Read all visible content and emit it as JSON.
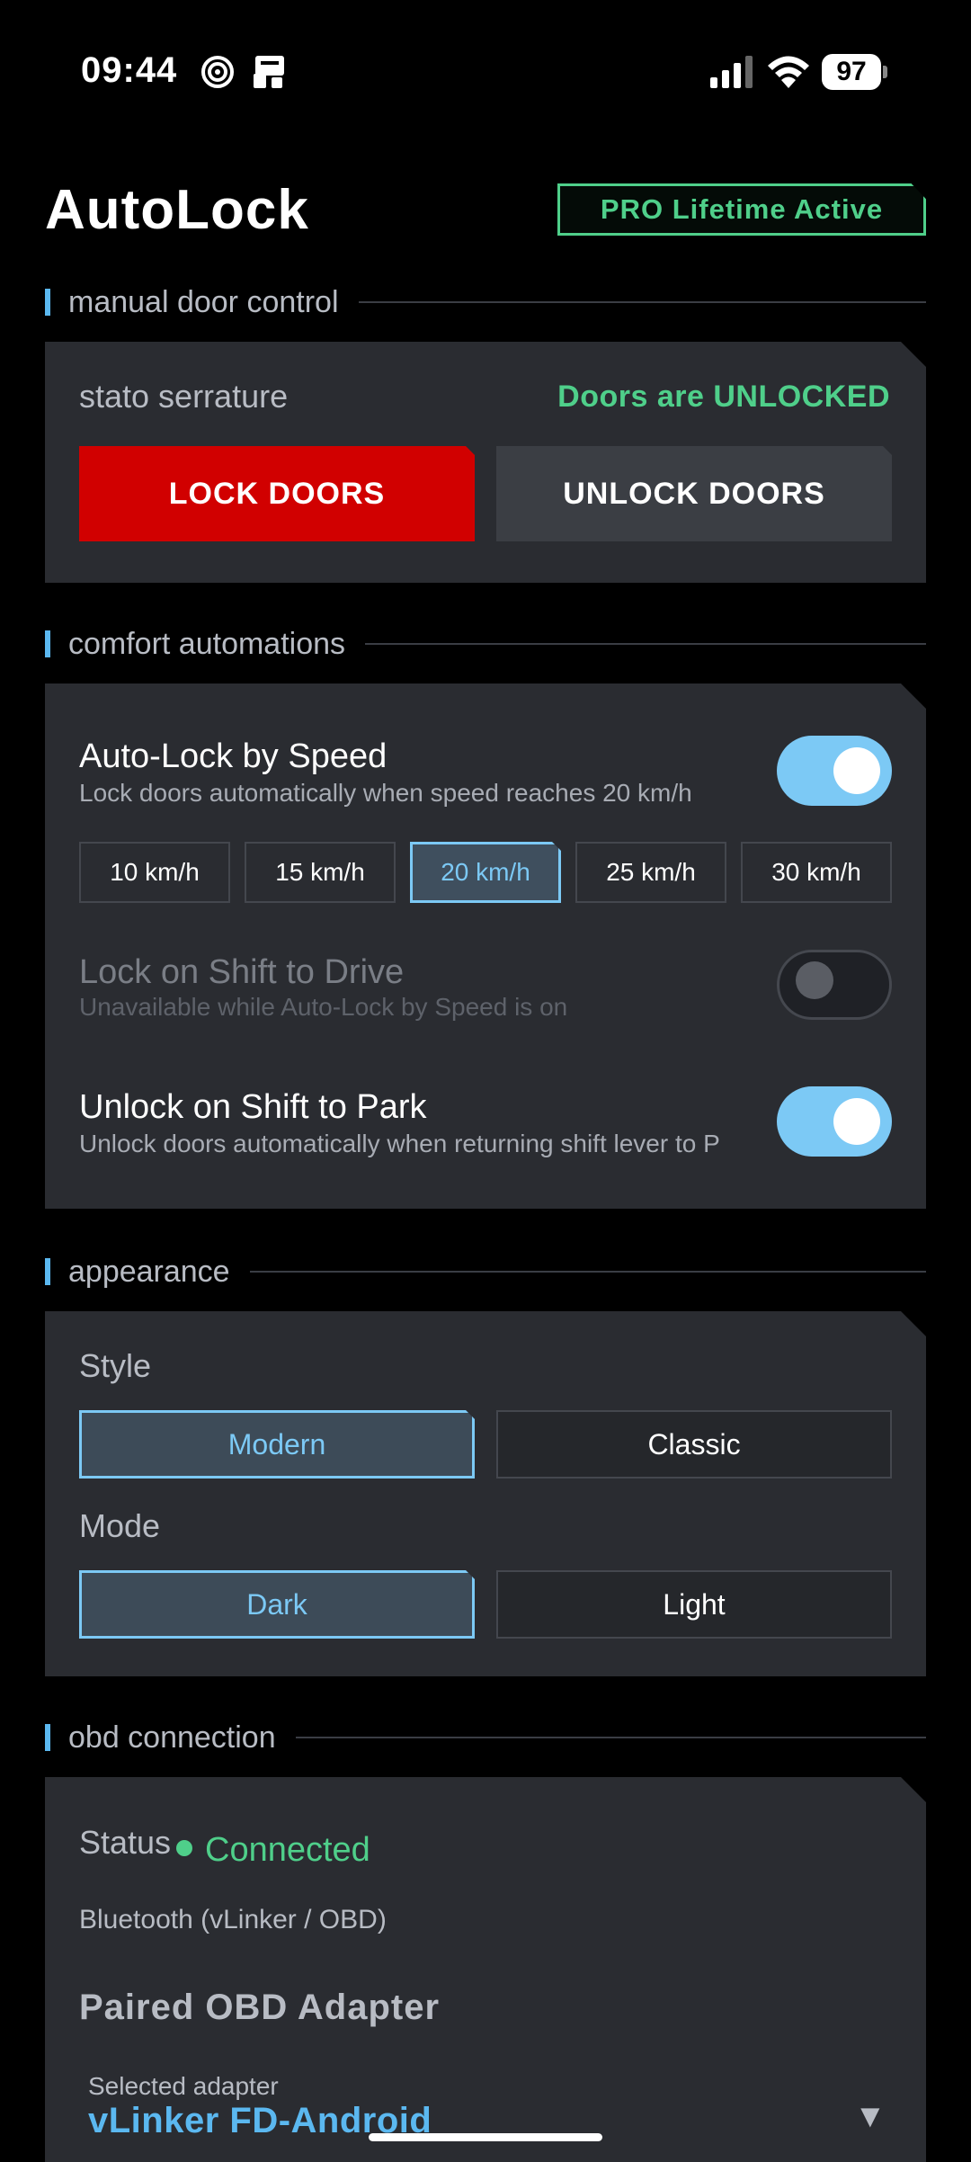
{
  "status_bar": {
    "time": "09:44",
    "battery": "97",
    "icons": [
      "spiral-icon",
      "cast-icon",
      "signal-icon",
      "wifi-icon",
      "battery-icon"
    ]
  },
  "header": {
    "title": "AutoLock",
    "badge": "PRO Lifetime Active"
  },
  "colors": {
    "accent": "#7cc9f5",
    "success": "#4fcf8a",
    "danger": "#d10000",
    "card": "#2a2c31"
  },
  "manual": {
    "section_label": "manual door control",
    "lock_label": "stato serrature",
    "lock_status": "Doors are UNLOCKED",
    "lock_button": "LOCK DOORS",
    "unlock_button": "UNLOCK DOORS"
  },
  "comfort": {
    "section_label": "comfort automations",
    "speed_lock": {
      "title": "Auto-Lock by Speed",
      "subtitle": "Lock doors automatically when speed reaches 20 km/h",
      "enabled": true,
      "options": [
        "10 km/h",
        "15 km/h",
        "20 km/h",
        "25 km/h",
        "30 km/h"
      ],
      "selected": "20 km/h"
    },
    "shift_drive": {
      "title": "Lock on Shift to Drive",
      "subtitle": "Unavailable while Auto-Lock by Speed is on",
      "enabled": false
    },
    "shift_park": {
      "title": "Unlock on Shift to Park",
      "subtitle": "Unlock doors automatically when returning shift lever to P",
      "enabled": true
    }
  },
  "appearance": {
    "section_label": "appearance",
    "style_label": "Style",
    "style_options": [
      "Modern",
      "Classic"
    ],
    "style_selected": "Modern",
    "mode_label": "Mode",
    "mode_options": [
      "Dark",
      "Light"
    ],
    "mode_selected": "Dark"
  },
  "obd": {
    "section_label": "obd connection",
    "status_label": "Status",
    "status_value": "Connected",
    "transport": "Bluetooth (vLinker / OBD)",
    "paired_title": "Paired OBD Adapter",
    "selected_label": "Selected adapter",
    "selected_value": "vLinker FD-Android",
    "caret": "▼"
  }
}
